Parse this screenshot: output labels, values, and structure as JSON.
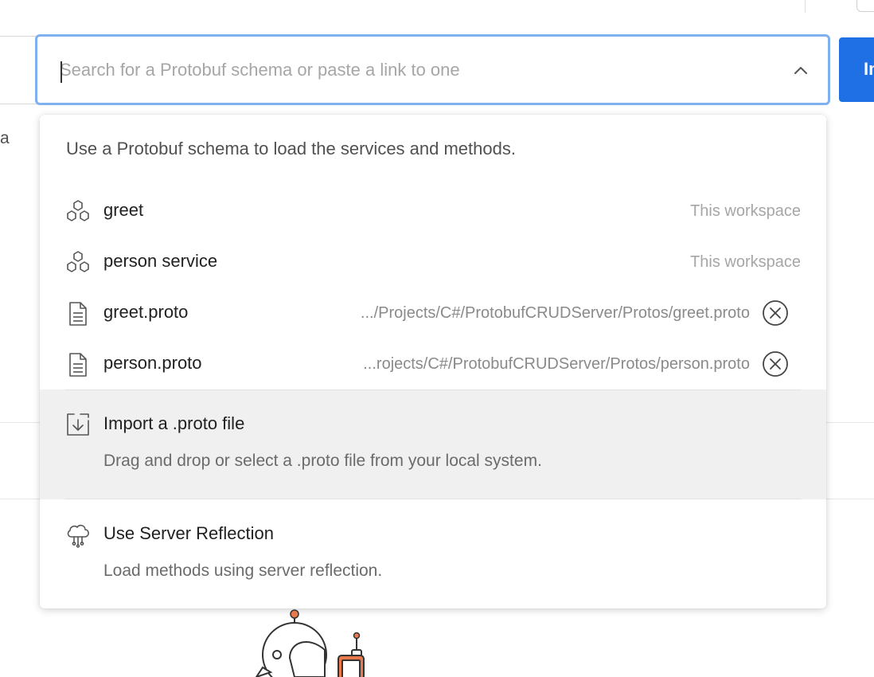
{
  "search": {
    "placeholder": "Search for a Protobuf schema or paste a link to one",
    "value": ""
  },
  "import_button": {
    "label": "Im"
  },
  "background": {
    "partial_text": "a"
  },
  "dropdown": {
    "hint": "Use a Protobuf schema to load the services and methods.",
    "schemas": [
      {
        "icon": "hexagons-icon",
        "label": "greet",
        "meta": "This workspace"
      },
      {
        "icon": "hexagons-icon",
        "label": "person service",
        "meta": "This workspace"
      }
    ],
    "files": [
      {
        "icon": "file-icon",
        "label": "greet.proto",
        "path": ".../Projects/C#/ProtobufCRUDServer/Protos/greet.proto"
      },
      {
        "icon": "file-icon",
        "label": "person.proto",
        "path": "...rojects/C#/ProtobufCRUDServer/Protos/person.proto"
      }
    ],
    "import_proto": {
      "icon": "import-file-icon",
      "title": "Import a .proto file",
      "description": "Drag and drop or select a .proto file from your local system."
    },
    "server_reflection": {
      "icon": "cloud-network-icon",
      "title": "Use Server Reflection",
      "description": "Load methods using server reflection."
    }
  },
  "colors": {
    "accent": "#1f6fe5",
    "focus_ring": "#7fb0f0",
    "highlight": "#f0f0f0",
    "illustration_orange": "#e8794d"
  }
}
